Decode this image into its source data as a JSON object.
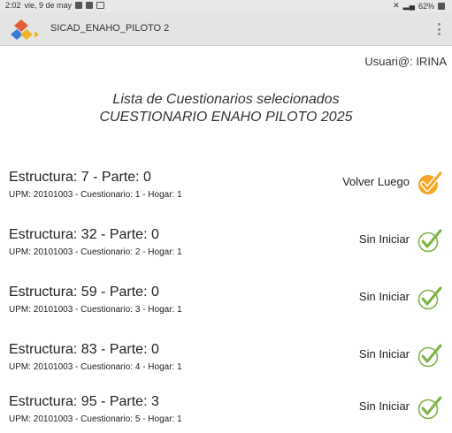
{
  "status_bar": {
    "time": "2:02",
    "date": "vie, 9 de may",
    "battery": "62%"
  },
  "app_bar": {
    "title": "SICAD_ENAHO_PILOTO 2"
  },
  "user": {
    "label": "Usuari@: IRINA"
  },
  "heading": {
    "line1": "Lista de Cuestionarios selecionados",
    "line2": "CUESTIONARIO ENAHO PILOTO 2025"
  },
  "rows": [
    {
      "title": "Estructura: 7 - Parte: 0",
      "subtitle": "UPM: 20101003 - Cuestionario: 1 - Hogar: 1",
      "status": "Volver Luego",
      "icon": "checkmark-orange-filled-icon"
    },
    {
      "title": "Estructura: 32 - Parte: 0",
      "subtitle": "UPM: 20101003 - Cuestionario: 2 - Hogar: 1",
      "status": "Sin Iniciar",
      "icon": "checkmark-green-outline-icon"
    },
    {
      "title": "Estructura: 59 - Parte: 0",
      "subtitle": "UPM: 20101003 - Cuestionario: 3 - Hogar: 1",
      "status": "Sin Iniciar",
      "icon": "checkmark-green-outline-icon"
    },
    {
      "title": "Estructura: 83 - Parte: 0",
      "subtitle": "UPM: 20101003 - Cuestionario: 4 - Hogar: 1",
      "status": "Sin Iniciar",
      "icon": "checkmark-green-outline-icon"
    },
    {
      "title": "Estructura: 95 - Parte: 3",
      "subtitle": "UPM: 20101003 - Cuestionario: 5 - Hogar: 1",
      "status": "Sin Iniciar",
      "icon": "checkmark-green-outline-icon"
    }
  ],
  "colors": {
    "orange_check": "#f5a623",
    "green_check": "#7cb342",
    "app_bar": "#e4e4e4"
  }
}
